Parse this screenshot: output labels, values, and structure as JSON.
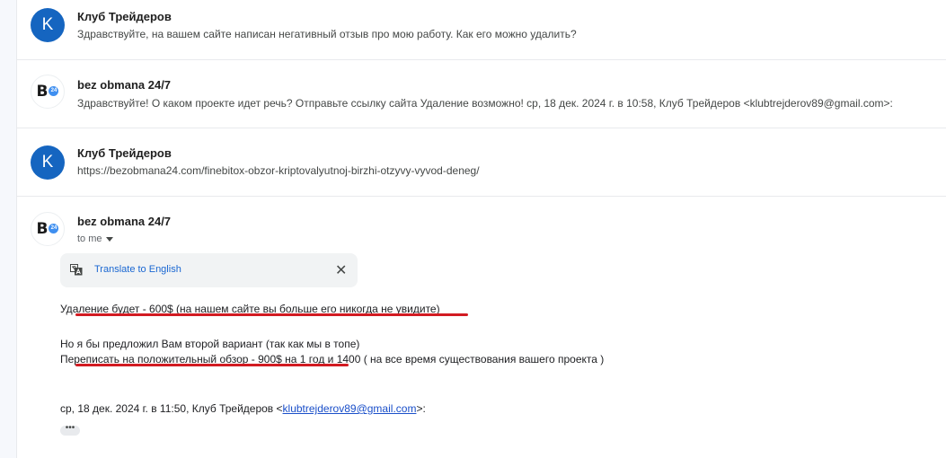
{
  "messages": [
    {
      "sender": "Клуб Трейдеров",
      "avatar_letter": "K",
      "snippet": "Здравствуйте, на вашем сайте написан негативный отзыв про мою работу. Как его можно удалить?"
    },
    {
      "sender": "bez obmana 24/7",
      "avatar_letter": "B",
      "avatar_badge": "24",
      "snippet": "Здравствуйте! О каком проекте идет речь? Отправьте ссылку сайта Удаление возможно! ср, 18 дек. 2024 г. в 10:58, Клуб Трейдеров <klubtrejderov89@gmail.com>:"
    },
    {
      "sender": "Клуб Трейдеров",
      "avatar_letter": "K",
      "snippet": "https://bezobmana24.com/finebitox-obzor-kriptovalyutnoj-birzhi-otzyvy-vyvod-deneg/"
    }
  ],
  "open_message": {
    "sender": "bez obmana 24/7",
    "avatar_letter": "B",
    "avatar_badge": "24",
    "recipient": "to me",
    "translate_label": "Translate to English",
    "translate_close": "✕",
    "body": {
      "line1": "Удаление будет - 600$ (на нашем сайте вы больше его никогда не увидите)",
      "line2": "Но я бы предложил Вам второй вариант (так как мы в топе)",
      "line3": "Переписать на положительный обзор - 900$ на 1 год и 1400 ( на все время существования вашего проекта )",
      "signature_prefix": "ср, 18 дек. 2024 г. в 11:50, Клуб Трейдеров <",
      "signature_email": "klubtrejderov89@gmail.com",
      "signature_suffix": ">:",
      "trimmed_content": "•••"
    }
  },
  "colors": {
    "avatar_k": "#1565c0",
    "link": "#1a67d2",
    "annotation_red": "#d21b22"
  }
}
